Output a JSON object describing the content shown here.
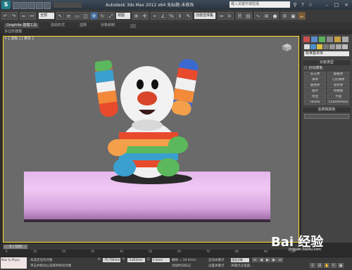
{
  "title_bar": {
    "app_logo": "S",
    "title": "Autodesk 3ds Max  2012 x64    无标题-未修改",
    "search_placeholder": "键入关键字或短语",
    "controls": [
      "minimize-icon",
      "maximize-icon",
      "close-icon"
    ]
  },
  "toolbar": {
    "selection_filter": "全部",
    "view_dropdown": "视图",
    "named_set_dropdown": "创建选择集"
  },
  "ribbon": {
    "tabs": [
      "Graphite 建模工具",
      "自由形式",
      "选择",
      "对象绘制"
    ],
    "sub_label": "多边形建模"
  },
  "viewport": {
    "label": "+ [ 透视 ] [ 真实 ]",
    "border_color": "#ffde2a"
  },
  "command_panel": {
    "category_dropdown": "标准基本体",
    "rollout_object_type": "对象类型",
    "autogrid": "自动栅格",
    "buttons": [
      "长方体",
      "圆锥体",
      "球体",
      "几何球体",
      "圆柱体",
      "管状体",
      "圆环",
      "四棱锥",
      "茶壶",
      "平面",
      "Hedra",
      "ChamferBox"
    ],
    "rollout_name_color": "名称和颜色"
  },
  "timeline": {
    "slider": "0 / 100",
    "ticks": [
      "0",
      "10",
      "20",
      "30",
      "40",
      "50",
      "60",
      "70",
      "80",
      "90",
      "100"
    ]
  },
  "status": {
    "maxscript": "Max to Physc",
    "line1": "未选定任何对象",
    "line2": "单击并拖动以选择并移动对象",
    "x_label": "X:",
    "x_value": "-70.769mm",
    "y_label": "Y:",
    "y_value": "-5.803mm",
    "z_label": "Z:",
    "z_value": "0.0mm",
    "grid": "栅格 = 10.0mm",
    "add_time_tag": "添加时间标记",
    "auto_key": "自动关键点",
    "set_key": "设置关键点",
    "selected": "选定对象",
    "key_filters": "关键点过滤器..."
  },
  "watermark": {
    "brand": "Bai 经验",
    "url": "jingyan.baidu.com"
  }
}
